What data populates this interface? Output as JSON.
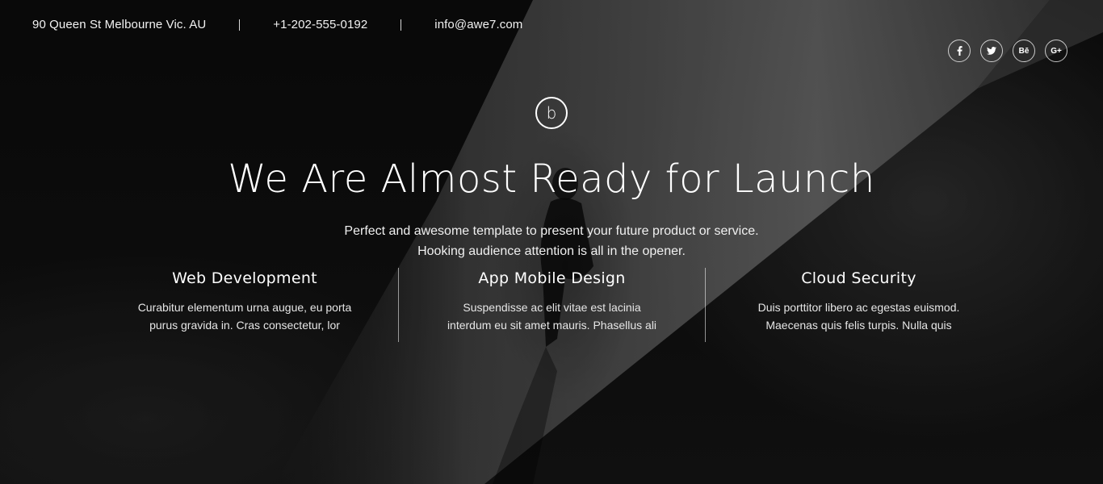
{
  "topbar": {
    "address": "90 Queen St Melbourne Vic. AU",
    "phone": "+1-202-555-0192",
    "email": "info@awe7.com"
  },
  "socials": [
    {
      "name": "facebook-icon",
      "glyph": "f"
    },
    {
      "name": "twitter-icon",
      "glyph": "twitter"
    },
    {
      "name": "behance-icon",
      "glyph": "Bē"
    },
    {
      "name": "google-plus-icon",
      "glyph": "G+"
    }
  ],
  "logo": {
    "letter": "b"
  },
  "hero": {
    "headline": "We Are Almost Ready for Launch",
    "subtext_line1": "Perfect and awesome template to present your future product or service.",
    "subtext_line2": "Hooking audience attention is all in the opener."
  },
  "features": [
    {
      "title": "Web Development",
      "text_line1": "Curabitur elementum urna augue, eu porta",
      "text_line2": "purus gravida in. Cras consectetur, lor"
    },
    {
      "title": "App Mobile Design",
      "text_line1": "Suspendisse ac elit vitae est lacinia",
      "text_line2": "interdum eu sit amet mauris. Phasellus ali"
    },
    {
      "title": "Cloud Security",
      "text_line1": "Duis porttitor libero ac egestas euismod.",
      "text_line2": "Maecenas quis felis turpis. Nulla quis"
    }
  ]
}
